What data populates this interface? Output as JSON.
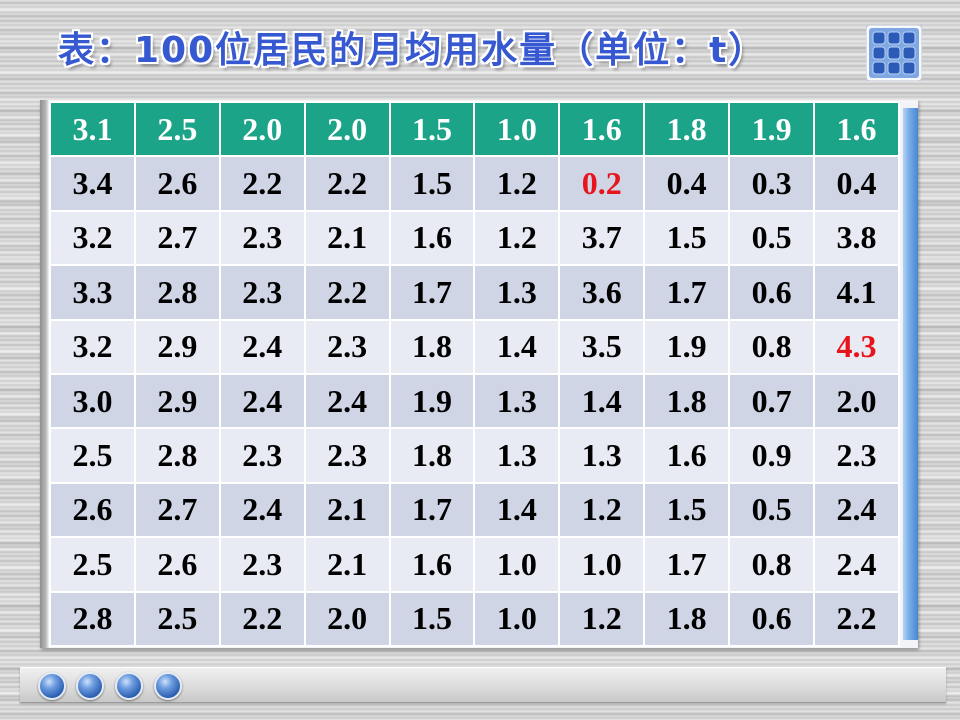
{
  "slide": {
    "title": "表：100位居民的月均用水量（单位：t）",
    "menu_icon": "grid-menu-icon",
    "nav_icons": [
      "blue-orb-icon",
      "blue-orb-icon",
      "blue-orb-icon",
      "blue-orb-icon"
    ]
  },
  "colors": {
    "title": "#3658d0",
    "first_row_background": "#1ca488",
    "first_row_text": "#ffffff",
    "band_dark": "#cfd5e5",
    "band_light": "#e8ebf3",
    "cell_text": "#000000",
    "highlight_text": "#e8141b"
  },
  "table": {
    "rows": [
      [
        "3.1",
        "2.5",
        "2.0",
        "2.0",
        "1.5",
        "1.0",
        "1.6",
        "1.8",
        "1.9",
        "1.6"
      ],
      [
        "3.4",
        "2.6",
        "2.2",
        "2.2",
        "1.5",
        "1.2",
        "0.2",
        "0.4",
        "0.3",
        "0.4"
      ],
      [
        "3.2",
        "2.7",
        "2.3",
        "2.1",
        "1.6",
        "1.2",
        "3.7",
        "1.5",
        "0.5",
        "3.8"
      ],
      [
        "3.3",
        "2.8",
        "2.3",
        "2.2",
        "1.7",
        "1.3",
        "3.6",
        "1.7",
        "0.6",
        "4.1"
      ],
      [
        "3.2",
        "2.9",
        "2.4",
        "2.3",
        "1.8",
        "1.4",
        "3.5",
        "1.9",
        "0.8",
        "4.3"
      ],
      [
        "3.0",
        "2.9",
        "2.4",
        "2.4",
        "1.9",
        "1.3",
        "1.4",
        "1.8",
        "0.7",
        "2.0"
      ],
      [
        "2.5",
        "2.8",
        "2.3",
        "2.3",
        "1.8",
        "1.3",
        "1.3",
        "1.6",
        "0.9",
        "2.3"
      ],
      [
        "2.6",
        "2.7",
        "2.4",
        "2.1",
        "1.7",
        "1.4",
        "1.2",
        "1.5",
        "0.5",
        "2.4"
      ],
      [
        "2.5",
        "2.6",
        "2.3",
        "2.1",
        "1.6",
        "1.0",
        "1.0",
        "1.7",
        "0.8",
        "2.4"
      ],
      [
        "2.8",
        "2.5",
        "2.2",
        "2.0",
        "1.5",
        "1.0",
        "1.2",
        "1.8",
        "0.6",
        "2.2"
      ]
    ],
    "highlighted_cells": [
      {
        "row": 1,
        "col": 6
      },
      {
        "row": 4,
        "col": 9
      }
    ]
  }
}
